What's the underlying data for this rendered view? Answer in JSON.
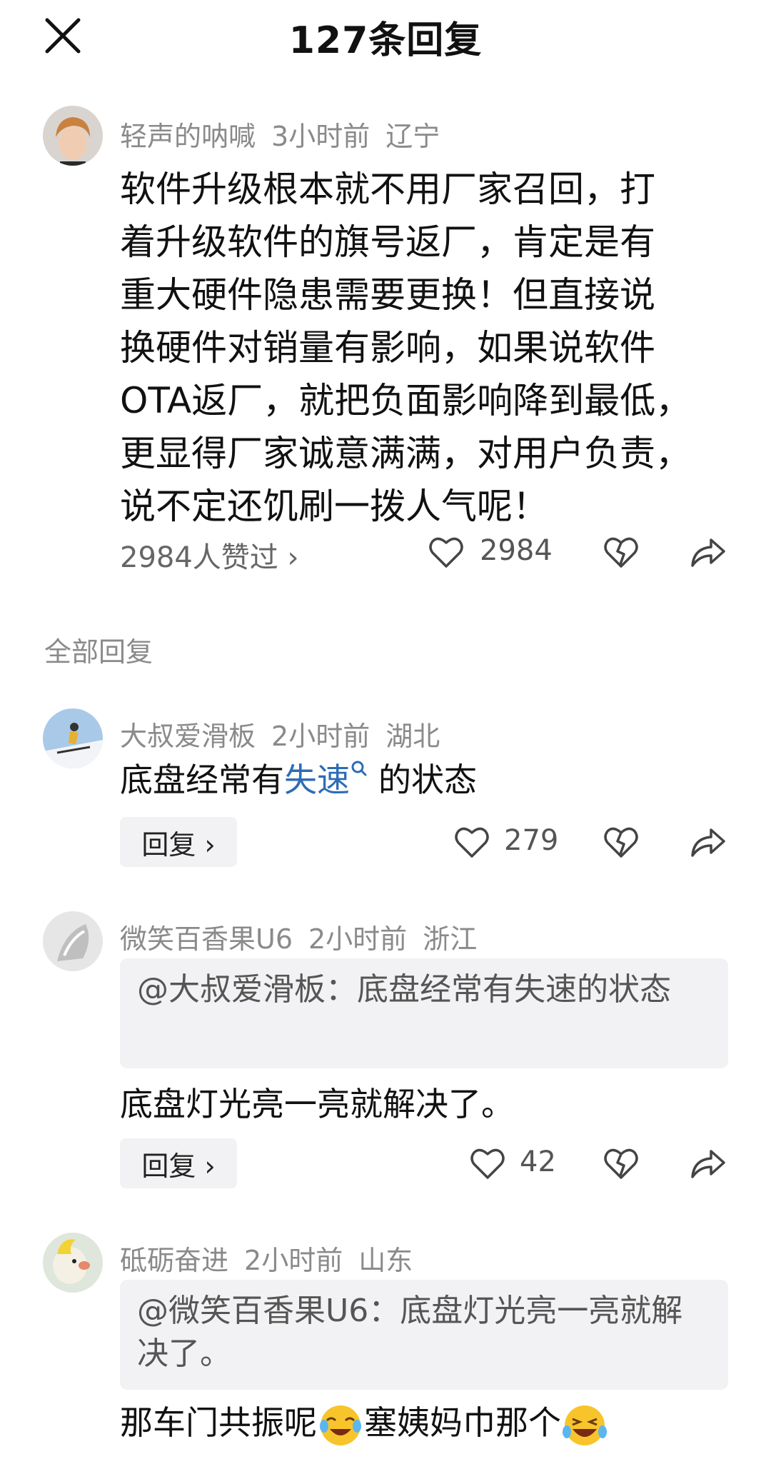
{
  "header": {
    "title": "127条回复"
  },
  "main_comment": {
    "user": "轻声的呐喊",
    "time": "3小时前",
    "location": "辽宁",
    "text_lines": [
      "软件升级根本就不用厂家召回，打",
      "着升级软件的旗号返厂，肯定是有",
      "重大硬件隐患需要更换！但直接说",
      "换硬件对销量有影响，如果说软件",
      "OTA返厂，就把负面影响降到最低，",
      "更显得厂家诚意满满，对用户负责，",
      "说不定还饥刷一拨人气呢！"
    ],
    "likes_link": "2984人赞过 ›",
    "like_count": "2984"
  },
  "section_label": "全部回复",
  "replies": [
    {
      "user": "大叔爱滑板",
      "time": "2小时前",
      "location": "湖北",
      "text_before": "底盘经常有",
      "text_link": "失速",
      "text_after": "的状态",
      "reply_label": "回复 ›",
      "like_count": "279"
    },
    {
      "user": "微笑百香果U6",
      "time": "2小时前",
      "location": "浙江",
      "quote": "@大叔爱滑板：底盘经常有失速的状态",
      "text": "底盘灯光亮一亮就解决了。",
      "reply_label": "回复 ›",
      "like_count": "42"
    },
    {
      "user": "砥砺奋进",
      "time": "2小时前",
      "location": "山东",
      "quote": "@微笑百香果U6：底盘灯光亮一亮就解决了。",
      "text_part1": "那车门共振呢",
      "text_part2": "塞姨妈巾那个"
    }
  ],
  "icons": {
    "close": "close-icon",
    "like": "heart-icon",
    "dislike": "broken-heart-icon",
    "share": "share-icon",
    "search": "search-icon"
  }
}
